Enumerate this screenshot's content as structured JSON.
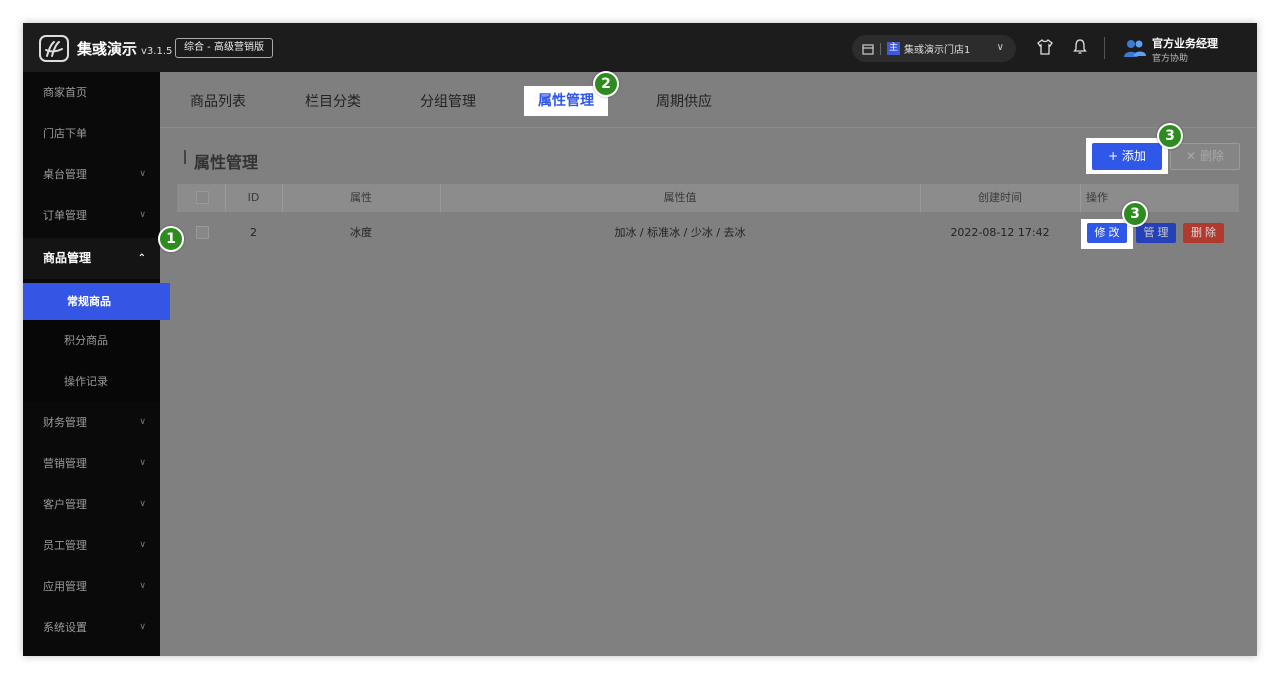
{
  "app": {
    "brand": "集彧演示",
    "version": "v3.1.5",
    "edition": "综合 - 高级营销版",
    "store_tag": "主",
    "store_name": "集彧演示门店1",
    "user_name": "官方业务经理",
    "user_role": "官方协助"
  },
  "sidebar": {
    "items": [
      {
        "label": "商家首页"
      },
      {
        "label": "门店下单"
      },
      {
        "label": "桌台管理"
      },
      {
        "label": "订单管理"
      },
      {
        "label": "商品管理"
      },
      {
        "label": "财务管理"
      },
      {
        "label": "营销管理"
      },
      {
        "label": "客户管理"
      },
      {
        "label": "员工管理"
      },
      {
        "label": "应用管理"
      },
      {
        "label": "系统设置"
      }
    ],
    "sub_items": [
      {
        "label": "常规商品"
      },
      {
        "label": "积分商品"
      },
      {
        "label": "操作记录"
      }
    ]
  },
  "tabs": [
    {
      "label": "商品列表"
    },
    {
      "label": "栏目分类"
    },
    {
      "label": "分组管理"
    },
    {
      "label": "属性管理"
    },
    {
      "label": "周期供应"
    }
  ],
  "page": {
    "title": "属性管理",
    "add_label": "+ 添加",
    "delete_label": "删除"
  },
  "table": {
    "headers": [
      "ID",
      "属性",
      "属性值",
      "创建时间",
      "操作"
    ],
    "rows": [
      {
        "id": "2",
        "name": "冰度",
        "values": "加冰 / 标准冰 / 少冰 / 去冰",
        "created": "2022-08-12 17:42"
      }
    ],
    "actions": {
      "edit": "修改",
      "manage": "管理",
      "delete": "删除"
    }
  },
  "badges": [
    "1",
    "2",
    "3",
    "3"
  ],
  "colors": {
    "accent": "#2f57e8",
    "danger": "#c0392b",
    "badge": "#2e8b1f"
  }
}
